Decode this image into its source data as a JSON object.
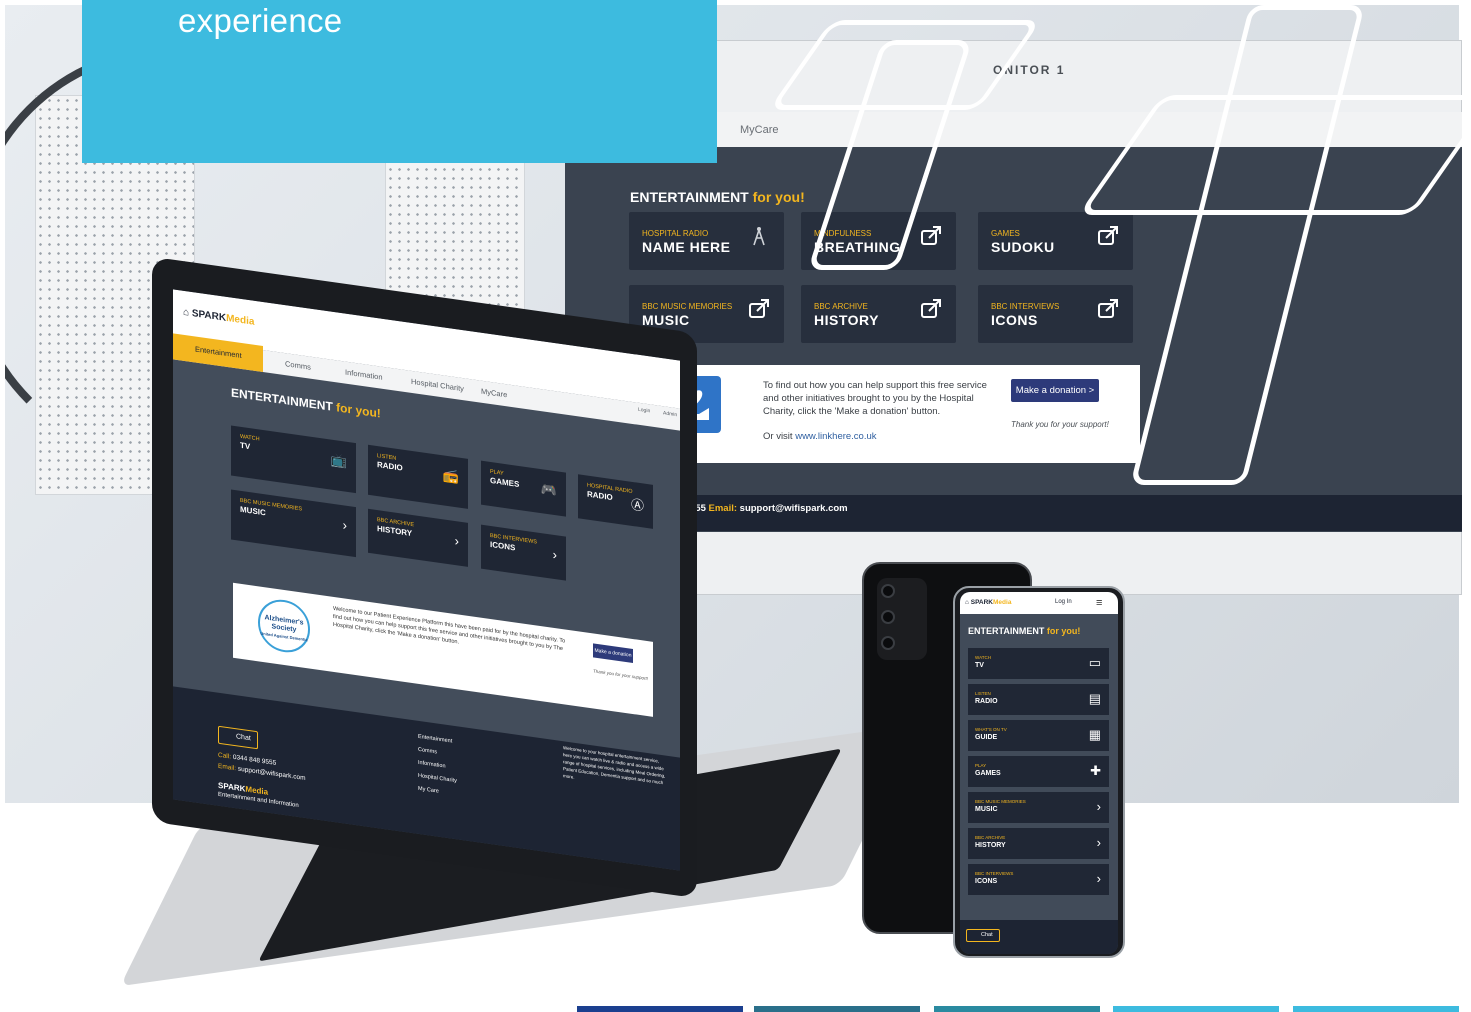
{
  "title_box": {
    "text": "experience"
  },
  "monitor": {
    "label": "ONITOR 1",
    "tab": "MyCare",
    "heading": "ENTERTAINMENT",
    "heading_accent": "for you!",
    "tiles": [
      {
        "category": "HOSPITAL RADIO",
        "name": "NAME HERE",
        "icon": "antenna-icon"
      },
      {
        "category": "MINDFULNESS",
        "name": "BREATHING",
        "icon": "external-link-icon"
      },
      {
        "category": "GAMES",
        "name": "SUDOKU",
        "icon": "external-link-icon"
      },
      {
        "category": "BBC MUSIC MEMORIES",
        "name": "MUSIC",
        "icon": "external-link-icon"
      },
      {
        "category": "BBC ARCHIVE",
        "name": "HISTORY",
        "icon": "external-link-icon"
      },
      {
        "category": "BBC INTERVIEWS",
        "name": "ICONS",
        "icon": "external-link-icon"
      }
    ],
    "banner_text": "To find out how you can help support this free service and other initiatives brought to you by the Hospital Charity, click the 'Make a donation' button.",
    "visit_prefix": "Or visit",
    "visit_link": "www.linkhere.co.uk",
    "donate": "Make a donation >",
    "thanks": "Thank you for your support!",
    "footer_phone_tail": "555",
    "footer_email_label": "Email:",
    "footer_email": "support@wifispark.com"
  },
  "laptop": {
    "logo": "SPARK",
    "logo_accent": "Media",
    "tabs": [
      "Entertainment",
      "Comms",
      "Information",
      "Hospital Charity",
      "MyCare"
    ],
    "login": "Login",
    "admin": "Admin",
    "heading": "ENTERTAINMENT",
    "heading_accent": "for you!",
    "tiles": [
      {
        "category": "WATCH",
        "name": "TV",
        "icon": "tv-icon"
      },
      {
        "category": "LISTEN",
        "name": "RADIO",
        "icon": "radio-icon"
      },
      {
        "category": "PLAY",
        "name": "GAMES",
        "icon": "gamepad-icon"
      },
      {
        "category": "HOSPITAL RADIO",
        "name": "RADIO",
        "icon": "antenna-icon"
      },
      {
        "category": "BBC MUSIC MEMORIES",
        "name": "MUSIC",
        "icon": "chevron-right-icon"
      },
      {
        "category": "BBC ARCHIVE",
        "name": "HISTORY",
        "icon": "chevron-right-icon"
      },
      {
        "category": "BBC INTERVIEWS",
        "name": "ICONS",
        "icon": "chevron-right-icon"
      }
    ],
    "banner_logo": "Alzheimer's Society",
    "banner_logo_sub": "United Against Dementia",
    "banner_text": "Welcome to our Patient Experience Platform this have been paid for by the hospital charity. To find out how you can help support this free service and other initiatives brought to you by The Hospital Charity, click the 'Make a donation' button.",
    "donate": "Make a donation >",
    "thanks": "Thank you for your support!",
    "chat": "Chat",
    "call_label": "Call:",
    "call": "0344 848 9555",
    "email_label": "Email:",
    "email": "support@wifispark.com",
    "brand": "SPARK",
    "brand_accent": "Media",
    "brand_sub": "Entertainment and Information",
    "footer_links": [
      "Entertainment",
      "Comms",
      "Information",
      "Hospital Charity",
      "My Care"
    ],
    "footer_desc": "Welcome to your hospital entertainment service, here you can watch live & radio and access a wide range of hospital services, including Meal Ordering, Patient Education, Dementia support and so much more."
  },
  "phone": {
    "logo": "SPARK",
    "logo_accent": "Media",
    "login": "Log In",
    "heading": "ENTERTAINMENT",
    "heading_accent": "for you!",
    "tiles": [
      {
        "category": "WATCH",
        "name": "TV",
        "icon": "tv-icon"
      },
      {
        "category": "LISTEN",
        "name": "RADIO",
        "icon": "radio-icon"
      },
      {
        "category": "WHAT'S ON TV",
        "name": "GUIDE",
        "icon": "guide-icon"
      },
      {
        "category": "PLAY",
        "name": "GAMES",
        "icon": "gamepad-icon"
      },
      {
        "category": "BBC MUSIC MEMORIES",
        "name": "MUSIC",
        "icon": "chevron-right-icon"
      },
      {
        "category": "BBC ARCHIVE",
        "name": "HISTORY",
        "icon": "chevron-right-icon"
      },
      {
        "category": "BBC INTERVIEWS",
        "name": "ICONS",
        "icon": "chevron-right-icon"
      }
    ],
    "chat": "Chat"
  },
  "colors": {
    "brand_blue": "#3dbbdf",
    "accent_yellow": "#f3b61f",
    "navy": "#1d2433",
    "strips": [
      "#1b3f8f",
      "#2a6f8a",
      "#2a8aa0",
      "#3dbbdf",
      "#3dbbdf"
    ]
  }
}
